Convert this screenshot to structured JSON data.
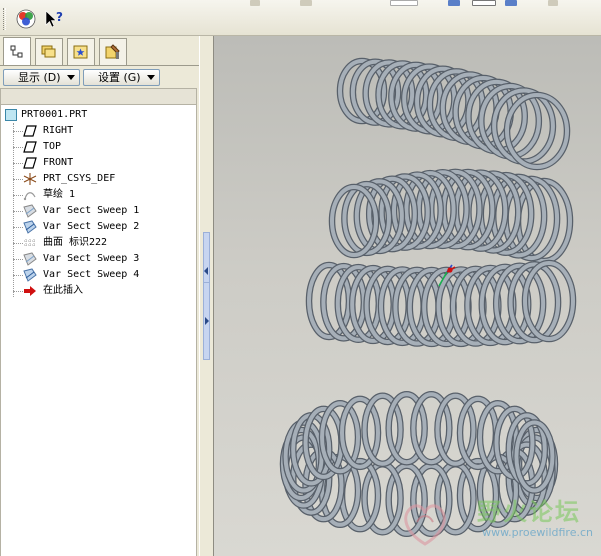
{
  "toolbar": {
    "icons": [
      "color-wheel-icon",
      "whats-this-help-icon"
    ]
  },
  "panel": {
    "tabs": [
      {
        "name": "model-tree",
        "icon": "tree-icon",
        "active": true
      },
      {
        "name": "folder-browser",
        "icon": "folders-icon",
        "active": false
      },
      {
        "name": "favorites",
        "icon": "favorites-icon",
        "active": false
      },
      {
        "name": "connections",
        "icon": "tools-icon",
        "active": false
      }
    ],
    "show_menu": "显示 (D)",
    "settings_menu": "设置 (G)"
  },
  "tree": {
    "root": "PRT0001.PRT",
    "items": [
      {
        "label": "RIGHT",
        "icon": "datum-plane-icon"
      },
      {
        "label": "TOP",
        "icon": "datum-plane-icon"
      },
      {
        "label": "FRONT",
        "icon": "datum-plane-icon"
      },
      {
        "label": "PRT_CSYS_DEF",
        "icon": "coordinate-system-icon"
      },
      {
        "label": "草绘 1",
        "icon": "sketch-icon"
      },
      {
        "label": "Var Sect Sweep 1",
        "icon": "var-sect-sweep-icon"
      },
      {
        "label": "Var Sect Sweep 2",
        "icon": "var-sect-sweep-icon"
      },
      {
        "label": "曲面 标识222",
        "icon": "surface-icon"
      },
      {
        "label": "Var Sect Sweep 3",
        "icon": "var-sect-sweep-icon"
      },
      {
        "label": "Var Sect Sweep 4",
        "icon": "var-sect-sweep-icon"
      },
      {
        "label": "在此插入",
        "icon": "insert-here-arrow-icon"
      }
    ]
  },
  "watermark": {
    "title": "野火论坛",
    "url": "www.proewildfire.cn"
  },
  "colors": {
    "panel_bg": "#ece9d8",
    "viewport_bg": "#cdccc6",
    "spring": "#a6afb8",
    "insert_arrow": "#d01010"
  }
}
